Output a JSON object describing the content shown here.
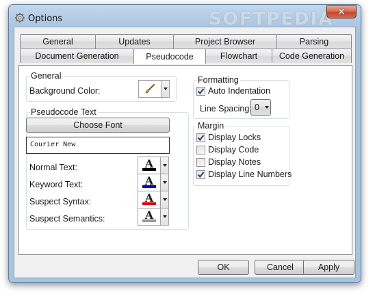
{
  "window": {
    "title": "Options",
    "watermark": "SOFTPEDIA"
  },
  "tabs_row1": [
    "General",
    "Updates",
    "Project Browser",
    "Parsing"
  ],
  "tabs_row2": [
    "Document Generation",
    "Pseudocode",
    "Flowchart",
    "Code Generation"
  ],
  "active_tab": "Pseudocode",
  "general_group": {
    "title": "General",
    "background_color_label": "Background Color:"
  },
  "pseudocode_text": {
    "title": "Pseudocode Text",
    "choose_font_label": "Choose Font",
    "font_preview": "Courier New",
    "rows": [
      {
        "label": "Normal Text:",
        "color": "#000000"
      },
      {
        "label": "Keyword Text:",
        "color": "#0000cc"
      },
      {
        "label": "Suspect Syntax:",
        "color": "#dd0000"
      },
      {
        "label": "Suspect Semantics:",
        "color": "#9a9a9a"
      }
    ],
    "glyph": "A"
  },
  "formatting": {
    "title": "Formatting",
    "auto_indentation_label": "Auto Indentation",
    "auto_indentation_checked": true,
    "line_spacing_label": "Line Spacing:",
    "line_spacing_value": "0"
  },
  "margin": {
    "title": "Margin",
    "options": [
      {
        "label": "Display Locks",
        "checked": true
      },
      {
        "label": "Display Code",
        "checked": false
      },
      {
        "label": "Display Notes",
        "checked": false
      },
      {
        "label": "Display Line Numbers",
        "checked": true
      }
    ]
  },
  "buttons": {
    "ok": "OK",
    "cancel": "Cancel",
    "apply": "Apply"
  },
  "icons": {
    "app": "settings-gear-icon",
    "close": "close-icon",
    "brush": "paintbrush-icon",
    "dropdown": "dropdown-arrow-icon",
    "check": "checkmark-icon"
  },
  "colors": {
    "title_bar": "#b2cbe4",
    "close_button": "#c2432a"
  }
}
